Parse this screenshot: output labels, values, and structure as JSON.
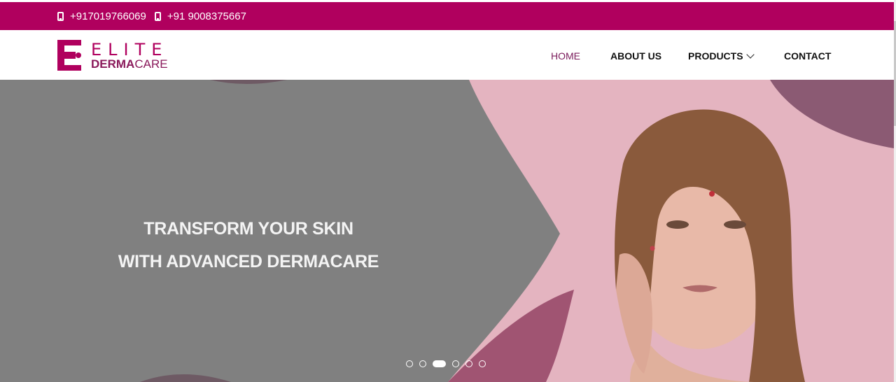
{
  "topbar": {
    "phones": [
      "+917019766069",
      "+91 9008375667"
    ],
    "color": "#b0005e"
  },
  "logo": {
    "line1": "ELITE",
    "line2_bold": "DERMA",
    "line2_rest": "CARE"
  },
  "nav": {
    "items": [
      {
        "label": "HOME",
        "active": true
      },
      {
        "label": "ABOUT US",
        "active": false
      },
      {
        "label": "PRODUCTS",
        "active": false,
        "has_dropdown": true
      },
      {
        "label": "CONTACT",
        "active": false
      }
    ]
  },
  "hero": {
    "line1": "TRANSFORM YOUR SKIN",
    "line2": "WITH ADVANCED DERMACARE",
    "slide_count": 6,
    "active_slide": 3
  },
  "colors": {
    "accent": "#b0005e",
    "hero_overlay": "#808080",
    "hero_pink": "#e8b6c2"
  }
}
